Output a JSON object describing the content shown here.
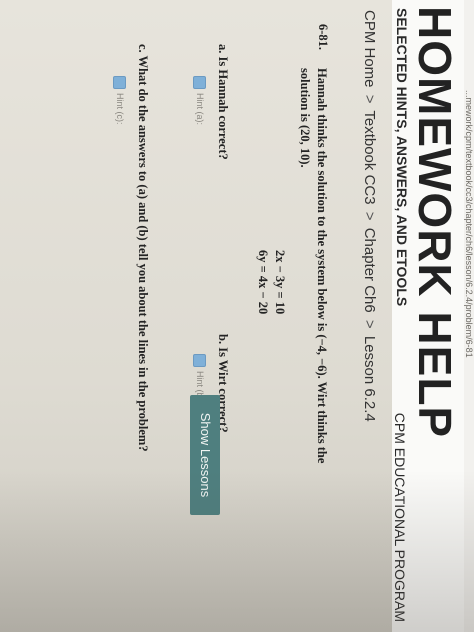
{
  "browser": {
    "url": "...mework/cpm/textbook/cc3/chapter/ch6/lesson/6.2.4/problem/6-81"
  },
  "header": {
    "title": "HOMEWORK HELP",
    "subtitle": "SELECTED HINTS, ANSWERS, AND ETOOLS",
    "brand": "CPM EDUCATIONAL PROGRAM"
  },
  "breadcrumb": {
    "items": [
      "CPM Home",
      "Textbook CC3",
      "Chapter Ch6",
      "Lesson 6.2.4"
    ],
    "separator": ">"
  },
  "show_lessons_label": "Show Lessons",
  "problem": {
    "number": "6-81.",
    "text": "Hannah thinks the solution to the system below is (−4, −6). Wirt thinks the solution is (20, 10).",
    "equations": [
      "2x − 3y = 10",
      "6y = 4x − 20"
    ],
    "parts": [
      {
        "letter": "a.",
        "question": "Is Hannah correct?",
        "hint_label": "Hint (a):"
      },
      {
        "letter": "b.",
        "question": "Is Wirt correct?",
        "hint_label": "Hint (b):"
      },
      {
        "letter": "c.",
        "question": "What do the answers to (a) and (b) tell you about the lines in the problem?",
        "hint_label": "Hint (c):"
      }
    ]
  },
  "colors": {
    "button_teal": "#4f7f7f",
    "hint_box": "#7fb0d8"
  }
}
